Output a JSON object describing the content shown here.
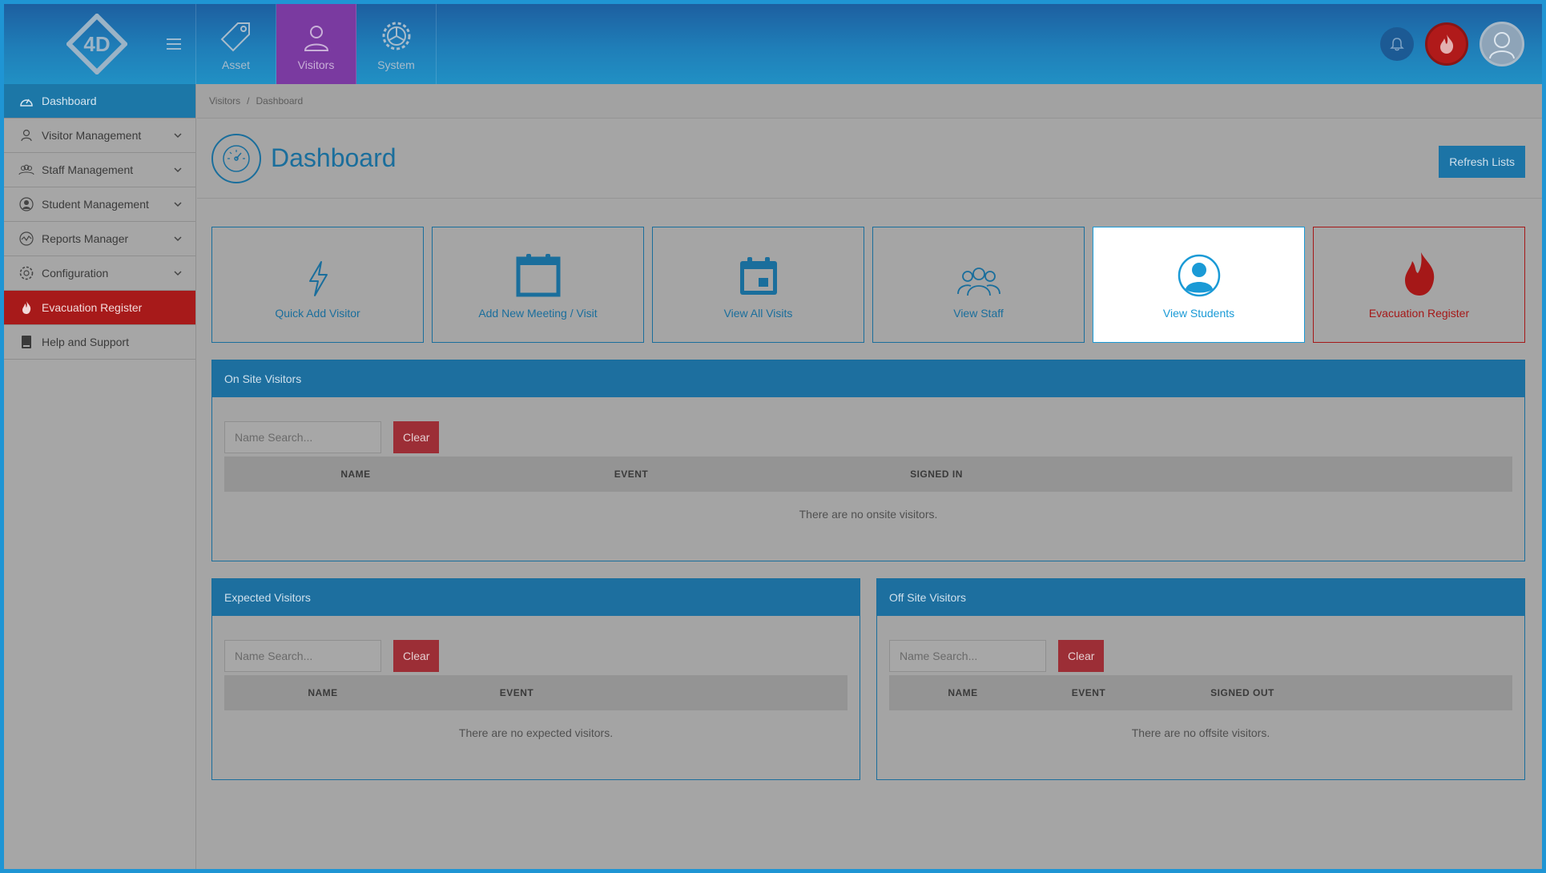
{
  "topnav": {
    "items": [
      {
        "label": "Asset",
        "icon": "tag-icon"
      },
      {
        "label": "Visitors",
        "icon": "person-icon"
      },
      {
        "label": "System",
        "icon": "gear-icon"
      }
    ]
  },
  "sidebar": {
    "items": [
      {
        "label": "Dashboard",
        "icon": "speedometer-icon"
      },
      {
        "label": "Visitor Management",
        "icon": "person-icon"
      },
      {
        "label": "Staff Management",
        "icon": "group-icon"
      },
      {
        "label": "Student Management",
        "icon": "student-icon"
      },
      {
        "label": "Reports Manager",
        "icon": "chart-icon"
      },
      {
        "label": "Configuration",
        "icon": "gear-icon"
      },
      {
        "label": "Evacuation Register",
        "icon": "flame-icon"
      },
      {
        "label": "Help and Support",
        "icon": "book-icon"
      }
    ]
  },
  "breadcrumb": {
    "parent": "Visitors",
    "separator": "/",
    "current": "Dashboard"
  },
  "header": {
    "title": "Dashboard",
    "refresh_label": "Refresh Lists"
  },
  "tiles": [
    {
      "label": "Quick Add Visitor",
      "icon": "lightning-icon"
    },
    {
      "label": "Add New Meeting / Visit",
      "icon": "calendar-icon"
    },
    {
      "label": "View All Visits",
      "icon": "calendar-event-icon"
    },
    {
      "label": "View Staff",
      "icon": "group-icon"
    },
    {
      "label": "View Students",
      "icon": "student-icon"
    },
    {
      "label": "Evacuation Register",
      "icon": "flame-icon"
    }
  ],
  "onsite": {
    "title": "On Site Visitors",
    "search_placeholder": "Name Search...",
    "clear_label": "Clear",
    "columns": [
      "NAME",
      "EVENT",
      "SIGNED IN"
    ],
    "empty": "There are no onsite visitors."
  },
  "expected": {
    "title": "Expected Visitors",
    "search_placeholder": "Name Search...",
    "clear_label": "Clear",
    "columns": [
      "NAME",
      "EVENT"
    ],
    "empty": "There are no expected visitors."
  },
  "offsite": {
    "title": "Off Site Visitors",
    "search_placeholder": "Name Search...",
    "clear_label": "Clear",
    "columns": [
      "NAME",
      "EVENT",
      "SIGNED OUT"
    ],
    "empty": "There are no offsite visitors."
  },
  "colors": {
    "brand_blue": "#1f95d4",
    "active_purple": "#7a3aa0",
    "evacuation_red": "#b01a1a"
  }
}
